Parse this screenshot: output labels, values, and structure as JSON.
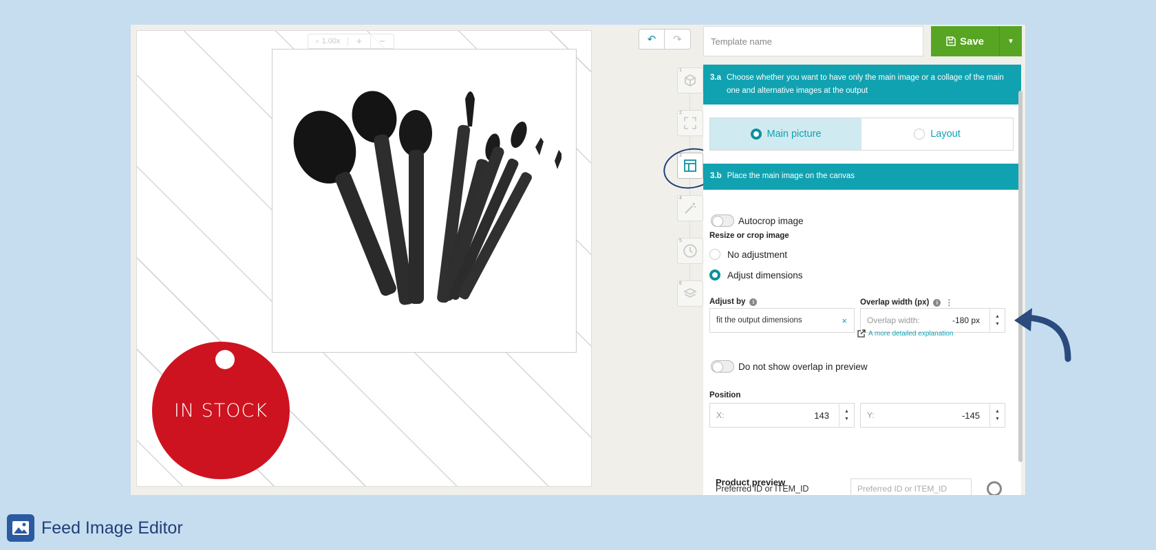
{
  "canvas": {
    "zoom_level": "1.00x",
    "zoom_in": "+",
    "zoom_out": "−",
    "badge_text": "IN STOCK"
  },
  "toolbar": {
    "template_placeholder": "Template name",
    "save_label": "Save"
  },
  "steps": [
    "1",
    "2",
    "3",
    "4",
    "5",
    "6"
  ],
  "section_a": {
    "number": "3.a",
    "text": "Choose whether you want to have only the main image or a collage of the main one and alternative images at the output",
    "options": [
      "Main picture",
      "Layout"
    ],
    "selected": "Main picture"
  },
  "section_b": {
    "number": "3.b",
    "text": "Place the main image on the canvas",
    "autocrop_label": "Autocrop image",
    "resize_label": "Resize or crop image",
    "resize_options": [
      "No adjustment",
      "Adjust dimensions"
    ],
    "resize_selected": "Adjust dimensions",
    "adjust_by_label": "Adjust by",
    "adjust_by_value": "fit the output dimensions",
    "overlap_label": "Overlap width (px)",
    "overlap_placeholder": "Overlap width:",
    "overlap_value": "-180 px",
    "explanation_link": "A more detailed explanation",
    "no_overlap_label": "Do not show overlap in preview",
    "position_label": "Position",
    "x_label": "X:",
    "x_value": "143",
    "y_label": "Y:",
    "y_value": "-145",
    "preview_title": "Product preview",
    "preferred_label": "Preferred ID or ITEM_ID",
    "preferred_placeholder": "Preferred ID or ITEM_ID"
  },
  "footer": {
    "title": "Feed Image Editor"
  },
  "colors": {
    "accent": "#11a2b1",
    "save": "#57a522",
    "badge": "#ce1320",
    "brand": "#1f3f76"
  }
}
